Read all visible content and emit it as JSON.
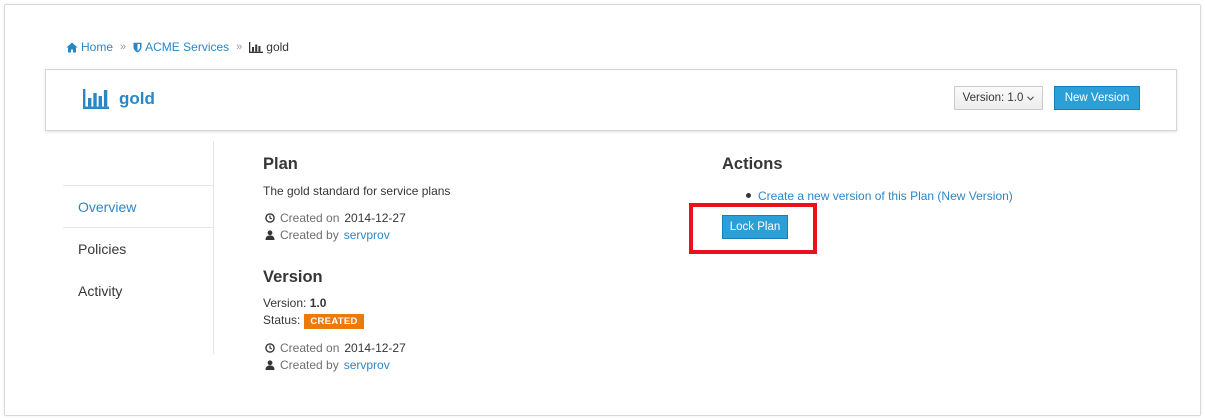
{
  "breadcrumb": {
    "home": "Home",
    "org": "ACME Services",
    "current": "gold",
    "separator": "»"
  },
  "header": {
    "title": "gold",
    "version_select": "Version: 1.0",
    "new_version_label": "New Version"
  },
  "sidebar": {
    "items": [
      {
        "label": "Overview",
        "active": true
      },
      {
        "label": "Policies",
        "active": false
      },
      {
        "label": "Activity",
        "active": false
      }
    ]
  },
  "plan": {
    "heading": "Plan",
    "description": "The gold standard for service plans",
    "created_on_label": "Created on",
    "created_on": "2014-12-27",
    "created_by_label": "Created by",
    "created_by": "servprov"
  },
  "version": {
    "heading": "Version",
    "version_label": "Version:",
    "version_value": "1.0",
    "status_label": "Status:",
    "status_value": "CREATED",
    "created_on_label": "Created on",
    "created_on": "2014-12-27",
    "created_by_label": "Created by",
    "created_by": "servprov"
  },
  "actions": {
    "heading": "Actions",
    "item": "Create a new version of this Plan (New Version)",
    "lock_label": "Lock Plan"
  },
  "colors": {
    "accent": "#2a87c6",
    "button": "#2a9fd8",
    "badge": "#ec7a08",
    "highlight": "#e8111d"
  }
}
